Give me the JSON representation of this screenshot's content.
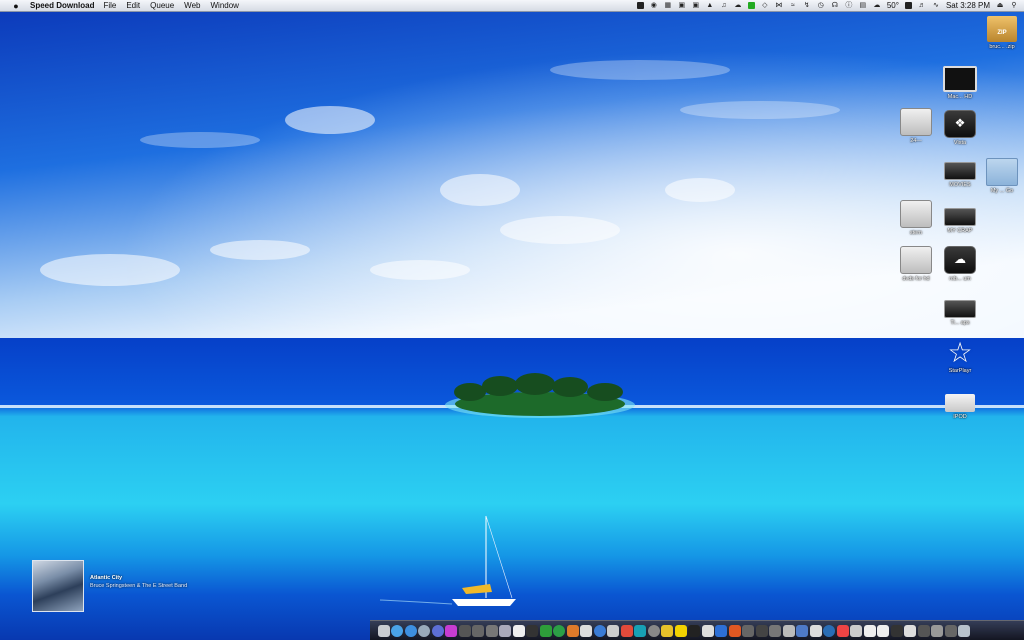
{
  "menubar": {
    "apple_icon": "apple-logo-icon",
    "app_name": "Speed Download",
    "menus": [
      "File",
      "Edit",
      "Queue",
      "Web",
      "Window"
    ],
    "temperature": "50°",
    "clock": "Sat 3:28 PM"
  },
  "desktop_icons": {
    "zip": "bruc... .zip",
    "mac_hd": "Mac... HD",
    "vista": "Vista",
    "drive_24": "24—",
    "movies": "MOVIES",
    "my_go": "My ... Go",
    "stern": "stern",
    "my_crap": "MY CRAP",
    "dvds": "dvds for hd",
    "rob": "rob... um",
    "ti_aps": "Ti... aps",
    "starplayr": "StarPlayr",
    "ipod": "IPOD"
  },
  "now_playing": {
    "track": "Atlantic City",
    "artist": "Bruce Springsteen & The E Street Band"
  },
  "colors": {
    "sky_top": "#0b3fc2",
    "sky_bottom": "#e9f3ff",
    "ocean_deep": "#0539c9",
    "lagoon": "#2fd0ef"
  }
}
